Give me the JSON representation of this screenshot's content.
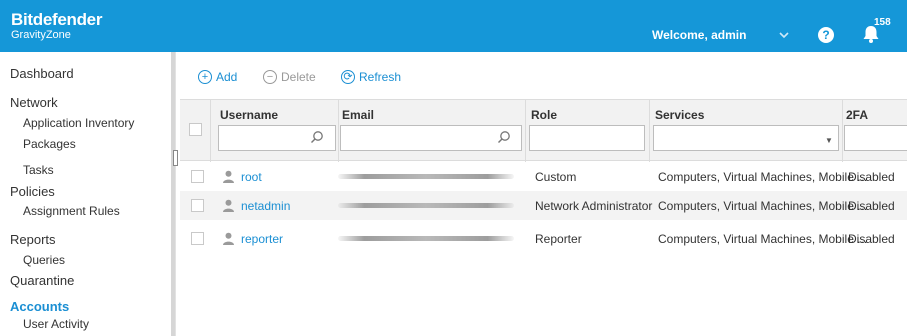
{
  "header": {
    "brand": "Bitdefender",
    "product": "GravityZone",
    "welcome": "Welcome, admin",
    "help_label": "?",
    "notification_count": "158",
    "colors": {
      "header_bg": "#1597d8",
      "accent": "#1b8fd3"
    },
    "icons": {
      "menu": "chevron-down-icon",
      "help": "help-icon",
      "notifications": "bell-icon"
    }
  },
  "sidebar": {
    "items": [
      {
        "label": "Dashboard",
        "level": 1
      },
      {
        "label": "Network",
        "level": 1
      },
      {
        "label": "Application Inventory",
        "level": 2
      },
      {
        "label": "Packages",
        "level": 2
      },
      {
        "label": "Tasks",
        "level": 2
      },
      {
        "label": "Policies",
        "level": 1
      },
      {
        "label": "Assignment Rules",
        "level": 2
      },
      {
        "label": "Reports",
        "level": 1
      },
      {
        "label": "Queries",
        "level": 2
      },
      {
        "label": "Quarantine",
        "level": 1
      },
      {
        "label": "Accounts",
        "level": 1,
        "active": true
      },
      {
        "label": "User Activity",
        "level": 2
      }
    ]
  },
  "toolbar": {
    "add_label": "Add",
    "delete_label": "Delete",
    "refresh_label": "Refresh",
    "icons": {
      "add": "plus-circle-icon",
      "delete": "minus-circle-icon",
      "refresh": "refresh-icon"
    }
  },
  "grid": {
    "columns": [
      "Username",
      "Email",
      "Role",
      "Services",
      "2FA"
    ],
    "filter_values": {
      "username": "",
      "email": "",
      "role": "",
      "services": "",
      "twofa": ""
    },
    "rows": [
      {
        "username": "root",
        "role": "Custom",
        "services": "Computers, Virtual Machines, Mobile ...",
        "twofa": "Disabled"
      },
      {
        "username": "netadmin",
        "role": "Network Administrator",
        "services": "Computers, Virtual Machines, Mobile ...",
        "twofa": "Disabled"
      },
      {
        "username": "reporter",
        "role": "Reporter",
        "services": "Computers, Virtual Machines, Mobile ...",
        "twofa": "Disabled"
      }
    ]
  }
}
